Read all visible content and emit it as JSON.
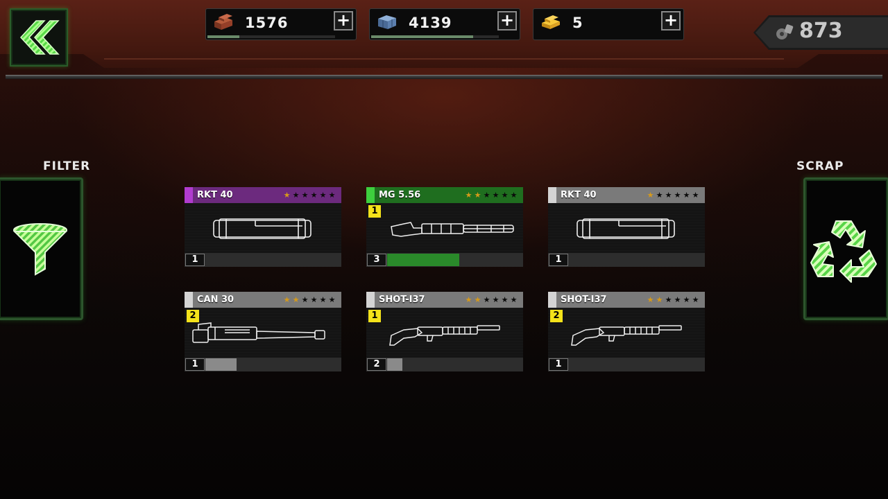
{
  "currencies": [
    {
      "name": "copper",
      "icon": "copper-ingot-icon",
      "value": "1576",
      "bar_fraction": 0.25
    },
    {
      "name": "steel",
      "icon": "steel-crate-icon",
      "value": "4139",
      "bar_fraction": 0.8
    },
    {
      "name": "gold",
      "icon": "gold-bar-icon",
      "value": "5",
      "bar_fraction": 0
    }
  ],
  "scrap_total": {
    "icon": "scrap-parts-icon",
    "value": "873"
  },
  "side": {
    "filter_label": "FILTER",
    "scrap_label": "SCRAP"
  },
  "cards": [
    {
      "name": "RKT 40",
      "rarity_color": "#b13ccf",
      "header_color": "#6c2a7e",
      "stars": 1,
      "max_stars": 6,
      "tier": "",
      "level": "1",
      "xp_fraction": 0,
      "xp_color": "#7a7a7a",
      "weapon": "rocket-launcher-icon"
    },
    {
      "name": "MG 5.56",
      "rarity_color": "#3ecf3e",
      "header_color": "#1f6e1f",
      "stars": 2,
      "max_stars": 6,
      "tier": "1",
      "level": "3",
      "xp_fraction": 0.53,
      "xp_color": "#2a8a2a",
      "weapon": "machine-gun-icon"
    },
    {
      "name": "RKT 40",
      "rarity_color": "#d4d4d4",
      "header_color": "#7a7a7a",
      "stars": 1,
      "max_stars": 6,
      "tier": "",
      "level": "1",
      "xp_fraction": 0,
      "xp_color": "#7a7a7a",
      "weapon": "rocket-launcher-icon"
    },
    {
      "name": "CAN 30",
      "rarity_color": "#d4d4d4",
      "header_color": "#7a7a7a",
      "stars": 2,
      "max_stars": 6,
      "tier": "2",
      "level": "1",
      "xp_fraction": 0.23,
      "xp_color": "#8a8a8a",
      "weapon": "cannon-icon"
    },
    {
      "name": "SHOT-I37",
      "rarity_color": "#d4d4d4",
      "header_color": "#7a7a7a",
      "stars": 2,
      "max_stars": 6,
      "tier": "1",
      "level": "2",
      "xp_fraction": 0.11,
      "xp_color": "#8a8a8a",
      "weapon": "shotgun-icon"
    },
    {
      "name": "SHOT-I37",
      "rarity_color": "#d4d4d4",
      "header_color": "#7a7a7a",
      "stars": 2,
      "max_stars": 6,
      "tier": "2",
      "level": "1",
      "xp_fraction": 0,
      "xp_color": "#8a8a8a",
      "weapon": "shotgun-icon"
    }
  ],
  "colors": {
    "accent_green": "#3ecf3e",
    "star_on": "#d69a1a",
    "tier_badge": "#f4e21a"
  }
}
